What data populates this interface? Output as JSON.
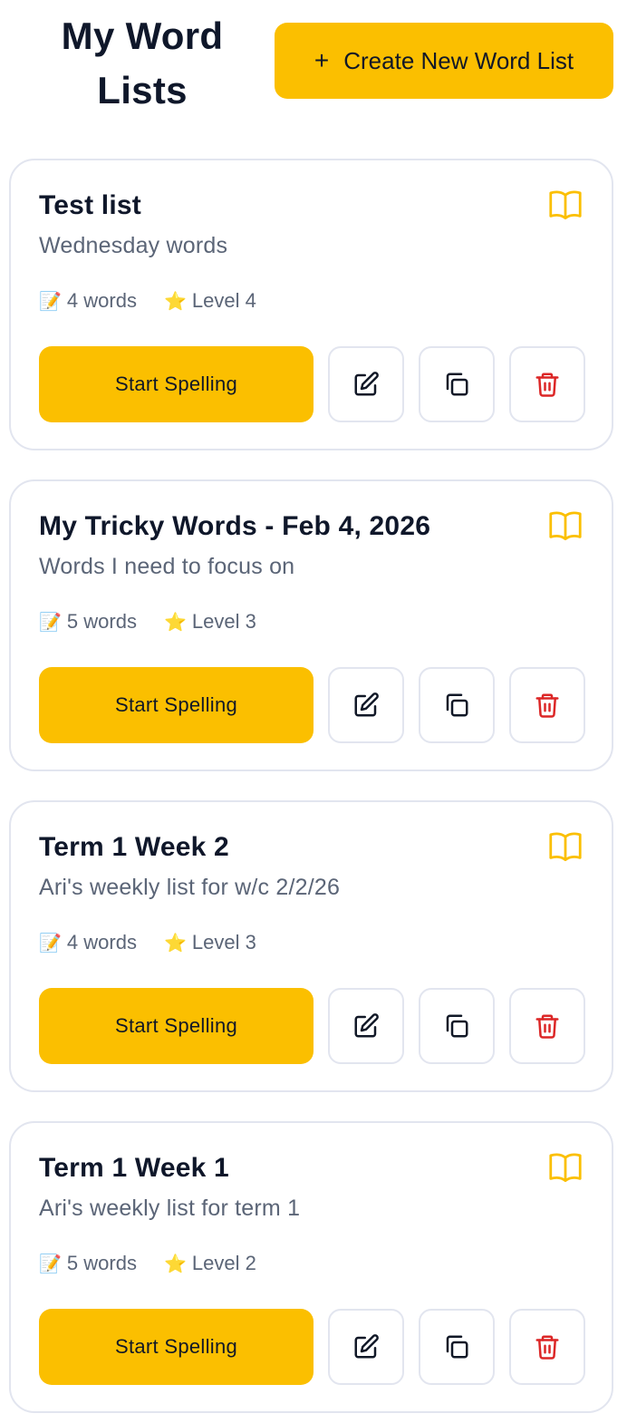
{
  "header": {
    "title": "My Word Lists",
    "create_label": "Create New Word List"
  },
  "colors": {
    "accent": "#fbbf00",
    "delete": "#dc2626",
    "book": "#fbbf00"
  },
  "lists": [
    {
      "title": "Test list",
      "description": "Wednesday words",
      "words": "4 words",
      "level": "Level 4",
      "start_label": "Start Spelling"
    },
    {
      "title": "My Tricky Words - Feb 4, 2026",
      "description": "Words I need to focus on",
      "words": "5 words",
      "level": "Level 3",
      "start_label": "Start Spelling"
    },
    {
      "title": "Term 1 Week 2",
      "description": "Ari's weekly list for w/c 2/2/26",
      "words": "4 words",
      "level": "Level 3",
      "start_label": "Start Spelling"
    },
    {
      "title": "Term 1 Week 1",
      "description": "Ari's weekly list for term 1",
      "words": "5 words",
      "level": "Level 2",
      "start_label": "Start Spelling"
    }
  ],
  "icons": {
    "book": "book-open-icon",
    "edit": "edit-icon",
    "copy": "copy-icon",
    "delete": "trash-icon",
    "words_emoji": "📝",
    "level_emoji": "⭐"
  }
}
